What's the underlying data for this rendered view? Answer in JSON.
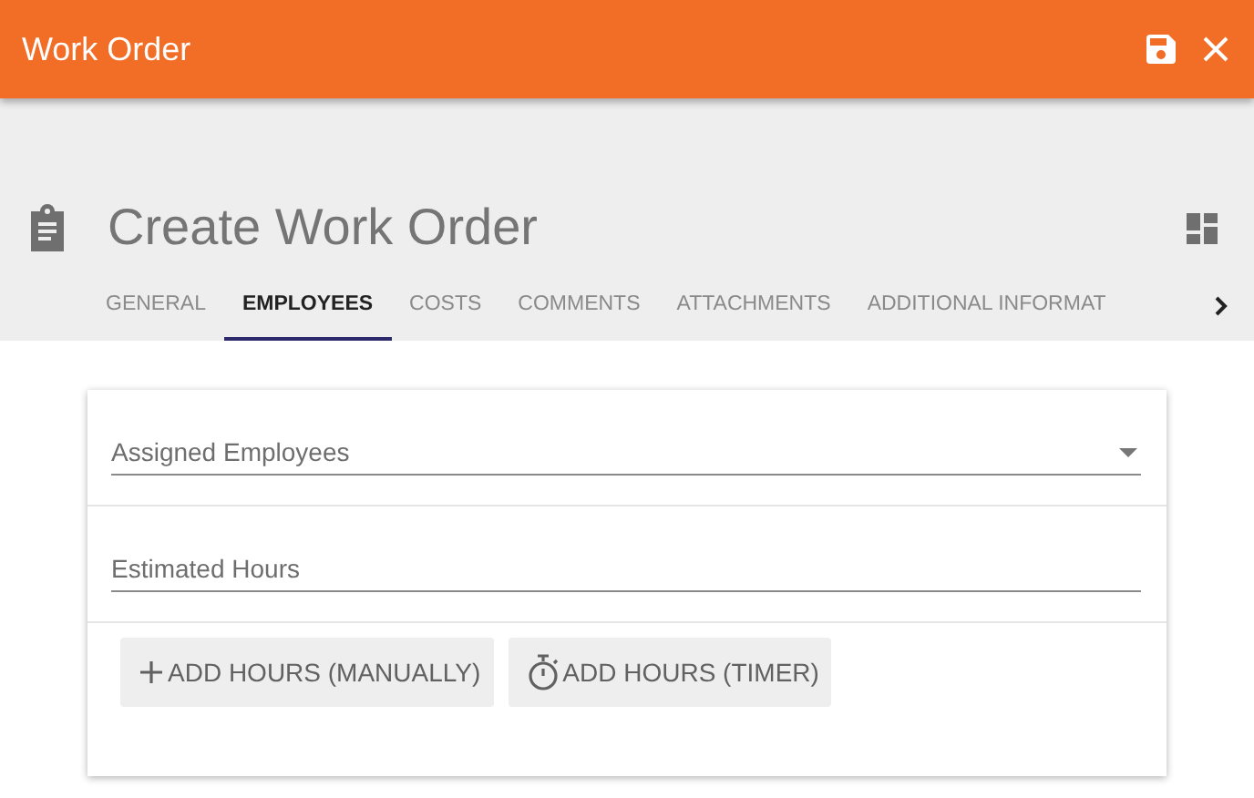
{
  "app_bar": {
    "title": "Work Order"
  },
  "page": {
    "title": "Create Work Order"
  },
  "tabs": [
    {
      "label": "GENERAL",
      "selected": false
    },
    {
      "label": "EMPLOYEES",
      "selected": true
    },
    {
      "label": "COSTS",
      "selected": false
    },
    {
      "label": "COMMENTS",
      "selected": false
    },
    {
      "label": "ATTACHMENTS",
      "selected": false
    },
    {
      "label": "ADDITIONAL INFORMAT",
      "selected": false
    }
  ],
  "fields": [
    {
      "kind": "select",
      "placeholder": "Assigned Employees"
    },
    {
      "kind": "text",
      "placeholder": "Estimated Hours"
    }
  ],
  "buttons": [
    {
      "kind": "add",
      "label": "ADD HOURS (MANUALLY)"
    },
    {
      "kind": "timer",
      "label": "ADD HOURS (TIMER)"
    }
  ]
}
